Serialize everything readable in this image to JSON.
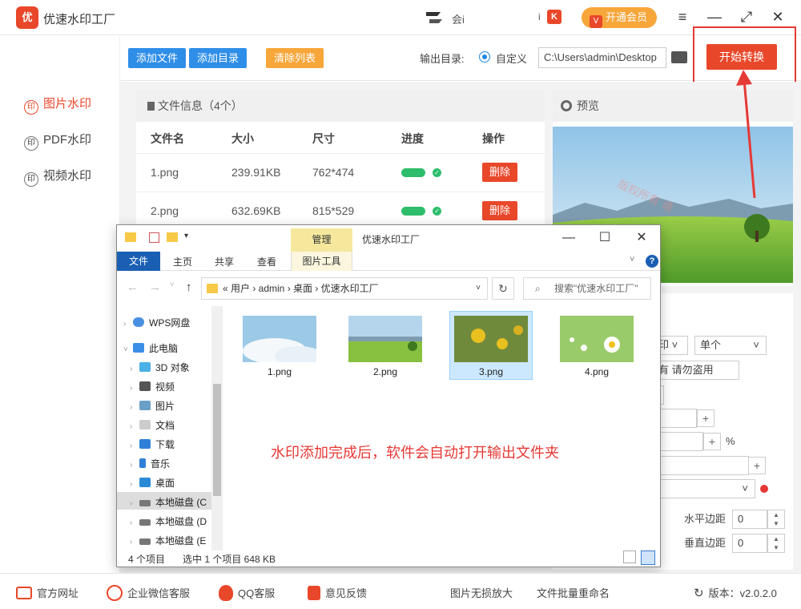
{
  "app": {
    "title": "优速水印工厂",
    "logo_text": "优",
    "ad_text": "会i",
    "badge_prefix": "i",
    "badge_icon": "K",
    "vip_label": "开通会员",
    "vip_icon": "V",
    "accent_color": "#e9472a"
  },
  "window_controls": {
    "menu": "≡",
    "minimize": "—",
    "maximize": "⤢",
    "close": "✕"
  },
  "sidebar": {
    "items": [
      {
        "label": "图片水印",
        "icon": "watermark-icon",
        "active": true
      },
      {
        "label": "PDF水印",
        "icon": "watermark-icon",
        "active": false
      },
      {
        "label": "视频水印",
        "icon": "watermark-icon",
        "active": false
      }
    ]
  },
  "toolbar": {
    "add_file": "添加文件",
    "add_dir": "添加目录",
    "clear_list": "清除列表",
    "output_label": "输出目录:",
    "radio_label": "自定义",
    "output_path": "C:\\Users\\admin\\Desktop",
    "start_button": "开始转换"
  },
  "file_panel": {
    "header": "文件信息（4个）",
    "columns": [
      "文件名",
      "大小",
      "尺寸",
      "进度",
      "操作"
    ],
    "rows": [
      {
        "name": "1.png",
        "size": "239.91KB",
        "dims": "762*474",
        "action": "删除"
      },
      {
        "name": "2.png",
        "size": "632.69KB",
        "dims": "815*529",
        "action": "删除"
      }
    ]
  },
  "preview": {
    "header": "预览",
    "watermark_text": "版权所有 请"
  },
  "settings": {
    "select1": "印",
    "select2": "单个",
    "text_field": "有 请勿盗用",
    "percent": "%",
    "h_margin_label": "水平边距",
    "h_margin_value": "0",
    "v_margin_label": "垂直边距",
    "v_margin_value": "0"
  },
  "explorer": {
    "manage_tab": "管理",
    "title": "优速水印工厂",
    "ribbon_tabs": [
      "文件",
      "主页",
      "共享",
      "查看",
      "图片工具"
    ],
    "breadcrumb": "« 用户 › admin › 桌面 › 优速水印工厂",
    "search_placeholder": "搜索\"优速水印工厂\"",
    "nav_items": [
      {
        "label": "WPS网盘",
        "icon": "cloud-icon"
      },
      {
        "label": "此电脑",
        "icon": "computer-icon"
      },
      {
        "label": "3D 对象",
        "icon": "cube-icon"
      },
      {
        "label": "视频",
        "icon": "video-icon"
      },
      {
        "label": "图片",
        "icon": "picture-icon"
      },
      {
        "label": "文档",
        "icon": "document-icon"
      },
      {
        "label": "下载",
        "icon": "download-icon"
      },
      {
        "label": "音乐",
        "icon": "music-icon"
      },
      {
        "label": "桌面",
        "icon": "desktop-icon"
      },
      {
        "label": "本地磁盘 (C",
        "icon": "drive-icon"
      },
      {
        "label": "本地磁盘 (D",
        "icon": "drive-icon"
      },
      {
        "label": "本地磁盘 (E",
        "icon": "drive-icon"
      }
    ],
    "files": [
      {
        "name": "1.png"
      },
      {
        "name": "2.png"
      },
      {
        "name": "3.png",
        "selected": true
      },
      {
        "name": "4.png"
      }
    ],
    "message": "水印添加完成后，软件会自动打开输出文件夹",
    "status_count": "4 个项目",
    "status_selected": "选中 1 个项目  648 KB"
  },
  "bottom_bar": {
    "items": [
      {
        "label": "官方网址",
        "icon": "web-icon"
      },
      {
        "label": "企业微信客服",
        "icon": "wechat-icon"
      },
      {
        "label": "QQ客服",
        "icon": "qq-icon"
      },
      {
        "label": "意见反馈",
        "icon": "feedback-icon"
      },
      {
        "label": "图片无损放大",
        "icon": ""
      },
      {
        "label": "文件批量重命名",
        "icon": ""
      }
    ],
    "version": "版本：v2.0.2.0"
  }
}
